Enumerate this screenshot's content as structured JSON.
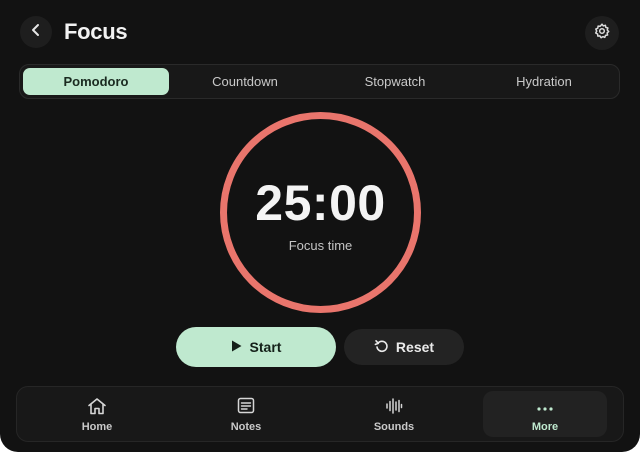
{
  "header": {
    "title": "Focus",
    "back_icon": "chevron-left-icon",
    "settings_icon": "gear-icon"
  },
  "tabs": [
    {
      "label": "Pomodoro",
      "active": true
    },
    {
      "label": "Countdown",
      "active": false
    },
    {
      "label": "Stopwatch",
      "active": false
    },
    {
      "label": "Hydration",
      "active": false
    }
  ],
  "timer": {
    "value": "25:00",
    "label": "Focus time",
    "ring_color": "#e9756c"
  },
  "controls": {
    "start_label": "Start",
    "start_icon": "play-icon",
    "reset_label": "Reset",
    "reset_icon": "reset-icon"
  },
  "nav": [
    {
      "label": "Home",
      "icon": "home-icon",
      "active": false
    },
    {
      "label": "Notes",
      "icon": "notes-icon",
      "active": false
    },
    {
      "label": "Sounds",
      "icon": "waveform-icon",
      "active": false
    },
    {
      "label": "More",
      "icon": "more-icon",
      "active": true
    }
  ],
  "colors": {
    "background": "#121212",
    "accent": "#bfe9cf",
    "ring": "#e9756c"
  }
}
